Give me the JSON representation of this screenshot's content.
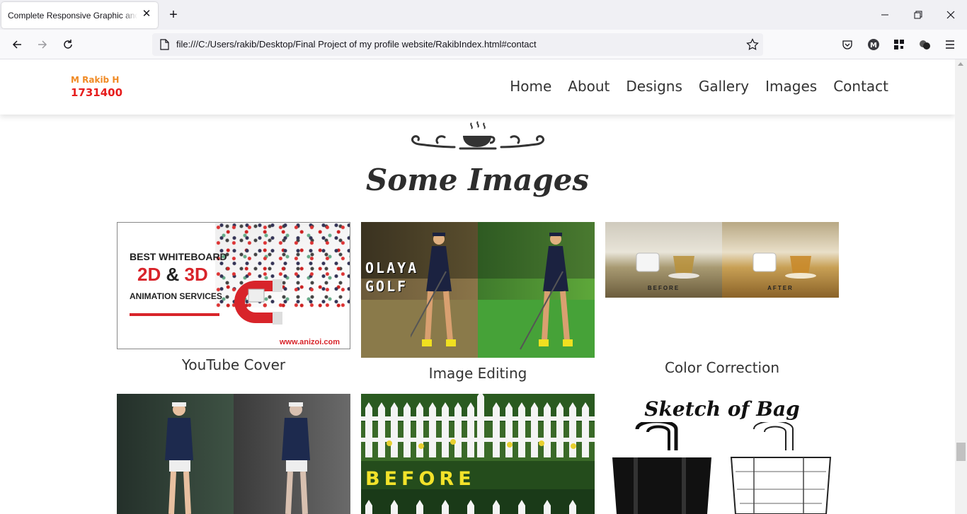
{
  "browser": {
    "tab_title": "Complete Responsive Graphic and w",
    "url": "file:///C:/Users/rakib/Desktop/Final Project of my profile website/RakibIndex.html#contact"
  },
  "site": {
    "logo_name": "M Rakib H",
    "logo_number": "1731400",
    "menu": [
      "Home",
      "About",
      "Designs",
      "Gallery",
      "Images",
      "Contact"
    ]
  },
  "section": {
    "title": "Some Images"
  },
  "gallery": {
    "items": [
      {
        "caption": "YouTube Cover",
        "line1": "BEST WHITEBOARD",
        "line2a": "2D",
        "line2b": " & ",
        "line2c": "3D",
        "line3": "ANIMATION SERVICES",
        "url": "www.anizoi.com"
      },
      {
        "caption": "Image Editing",
        "overlay_line1": "OLAYA",
        "overlay_line2": "GOLF"
      },
      {
        "caption": "Color Correction",
        "label_before": "BEFORE",
        "label_after": "AFTER"
      },
      {
        "caption": ""
      },
      {
        "caption": "",
        "label": "BEFORE"
      },
      {
        "caption": "",
        "title": "Sketch of Bag"
      }
    ]
  },
  "colors": {
    "logo_name": "#f08a24",
    "logo_number": "#e61e1e",
    "accent_red": "#d8242a",
    "fence_label": "#f3e32a"
  }
}
